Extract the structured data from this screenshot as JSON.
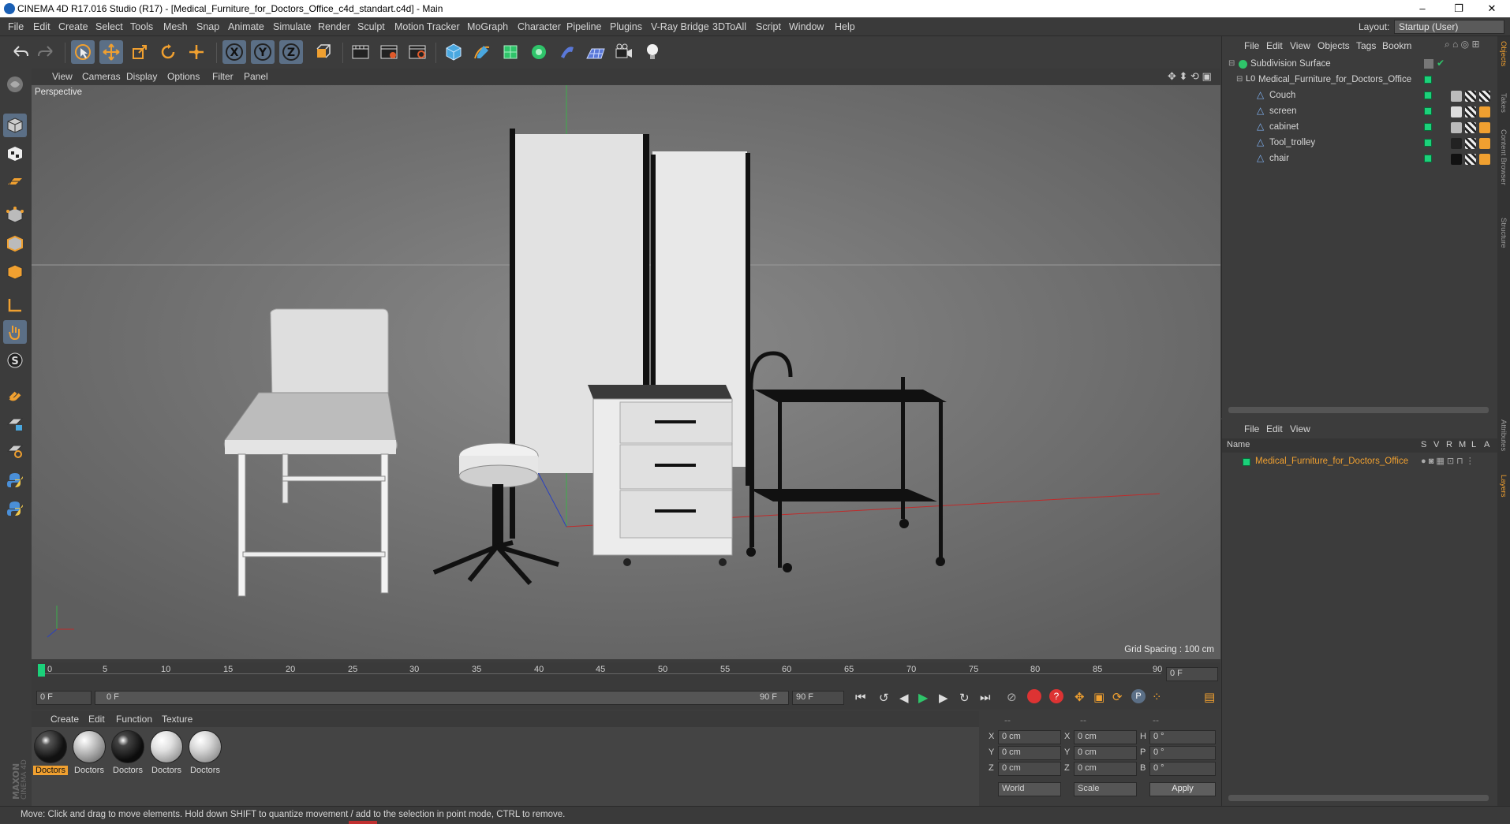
{
  "window": {
    "title": "CINEMA 4D R17.016 Studio (R17) - [Medical_Furniture_for_Doctors_Office_c4d_standart.c4d] - Main",
    "controls": [
      "–",
      "❐",
      "✕"
    ]
  },
  "menubar": {
    "items": [
      "File",
      "Edit",
      "Create",
      "Select",
      "Tools",
      "Mesh",
      "Snap",
      "Animate",
      "Simulate",
      "Render",
      "Sculpt",
      "Motion Tracker",
      "MoGraph",
      "Character",
      "Pipeline",
      "Plugins",
      "V-Ray Bridge",
      "3DToAll",
      "Script",
      "Window",
      "Help"
    ],
    "layout_label": "Layout:",
    "layout_value": "Startup (User)"
  },
  "viewport": {
    "menu": [
      "View",
      "Cameras",
      "Display",
      "Options",
      "Filter",
      "Panel"
    ],
    "label": "Perspective",
    "grid_spacing": "Grid Spacing : 100 cm"
  },
  "timeline": {
    "ticks": [
      "0",
      "5",
      "10",
      "15",
      "20",
      "25",
      "30",
      "35",
      "40",
      "45",
      "50",
      "55",
      "60",
      "65",
      "70",
      "75",
      "80",
      "85",
      "90"
    ],
    "frame_field": "0 F",
    "start_field": "0 F",
    "range_start": "0 F",
    "range_end": "90 F",
    "end_field": "90 F"
  },
  "materials": {
    "menu": [
      "Create",
      "Edit",
      "Function",
      "Texture"
    ],
    "items": [
      {
        "label": "Doctors",
        "selected": true,
        "color": "#111111"
      },
      {
        "label": "Doctors",
        "selected": false,
        "color": "#bdbdbd"
      },
      {
        "label": "Doctors",
        "selected": false,
        "color": "#1a1a1a"
      },
      {
        "label": "Doctors",
        "selected": false,
        "color": "#d9d9d9"
      },
      {
        "label": "Doctors",
        "selected": false,
        "color": "#cfcfcf"
      }
    ]
  },
  "coordinates": {
    "header": [
      "--",
      "--",
      "--"
    ],
    "rows": [
      {
        "a": "X",
        "av": "0 cm",
        "b": "X",
        "bv": "0 cm",
        "c": "H",
        "cv": "0 °"
      },
      {
        "a": "Y",
        "av": "0 cm",
        "b": "Y",
        "bv": "0 cm",
        "c": "P",
        "cv": "0 °"
      },
      {
        "a": "Z",
        "av": "0 cm",
        "b": "Z",
        "bv": "0 cm",
        "c": "B",
        "cv": "0 °"
      }
    ],
    "mode1": "World",
    "mode2": "Scale",
    "apply": "Apply"
  },
  "object_manager": {
    "menu": [
      "File",
      "Edit",
      "View",
      "Objects",
      "Tags",
      "Bookm"
    ],
    "objects": [
      {
        "name": "Subdivision Surface",
        "indent": 0
      },
      {
        "name": "Medical_Furniture_for_Doctors_Office",
        "indent": 1
      },
      {
        "name": "Couch",
        "indent": 2
      },
      {
        "name": "screen",
        "indent": 2
      },
      {
        "name": "cabinet",
        "indent": 2
      },
      {
        "name": "Tool_trolley",
        "indent": 2
      },
      {
        "name": "chair",
        "indent": 2
      }
    ]
  },
  "layer_manager": {
    "menu": [
      "File",
      "Edit",
      "View"
    ],
    "columns": [
      "Name",
      "S",
      "V",
      "R",
      "M",
      "L",
      "A"
    ],
    "layers": [
      {
        "name": "Medical_Furniture_for_Doctors_Office",
        "color": "#1bd17a"
      }
    ]
  },
  "right_tabs": [
    "Objects",
    "Takes",
    "Content Browser",
    "Structure",
    "Attributes",
    "Layers"
  ],
  "side_logo": "MAXON CINEMA 4D",
  "status": "Move: Click and drag to move elements. Hold down SHIFT to quantize movement / add to the selection in point mode, CTRL to remove.",
  "colors": {
    "accent": "#5b6f86",
    "highlight": "#f0a030",
    "green": "#1bd17a"
  }
}
